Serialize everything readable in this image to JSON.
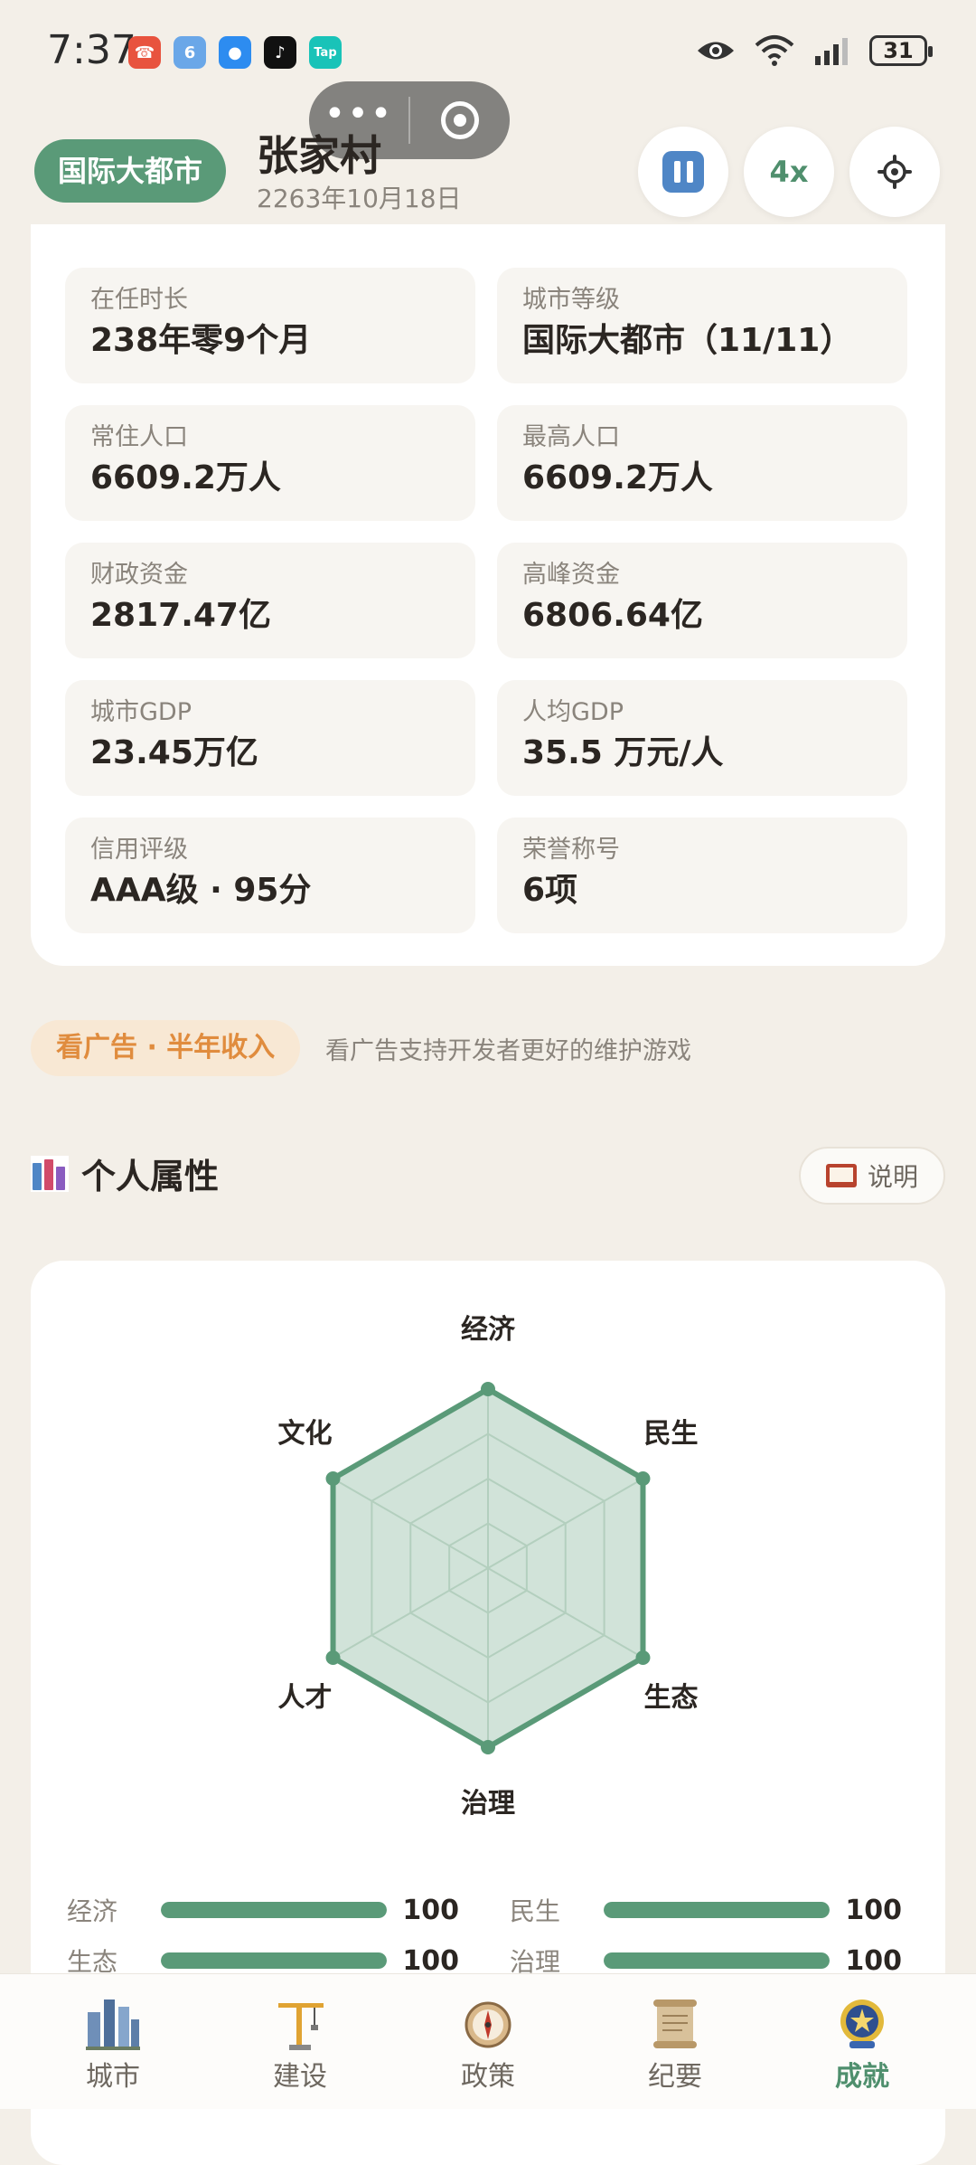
{
  "status_bar": {
    "time": "7:37",
    "battery": "31",
    "apps": [
      {
        "name": "phone-app-icon",
        "glyph": "☎",
        "color": "#e8533e"
      },
      {
        "name": "six-app-icon",
        "glyph": "6",
        "color": "#6aa7e8"
      },
      {
        "name": "chat-app-icon",
        "glyph": "●",
        "color": "#2d8cf0"
      },
      {
        "name": "tiktok-app-icon",
        "glyph": "♪",
        "color": "#111111"
      },
      {
        "name": "taptap-app-icon",
        "glyph": "Tap",
        "color": "#19c3b8"
      }
    ]
  },
  "header": {
    "level_pill": "国际大都市",
    "city_name": "张家村",
    "date": "2263年10月18日",
    "speed_label": "4x"
  },
  "stats": [
    {
      "label": "在任时长",
      "value": "238年零9个月"
    },
    {
      "label": "城市等级",
      "value": "国际大都市（11/11）"
    },
    {
      "label": "常住人口",
      "value": "6609.2万人"
    },
    {
      "label": "最高人口",
      "value": "6609.2万人"
    },
    {
      "label": "财政资金",
      "value": "2817.47亿"
    },
    {
      "label": "高峰资金",
      "value": "6806.64亿"
    },
    {
      "label": "城市GDP",
      "value": "23.45万亿"
    },
    {
      "label": "人均GDP",
      "value": "35.5 万元/人"
    },
    {
      "label": "信用评级",
      "value": "AAA级 · 95分"
    },
    {
      "label": "荣誉称号",
      "value": "6项"
    }
  ],
  "ad": {
    "button_label": "看广告 · 半年收入",
    "description": "看广告支持开发者更好的维护游戏"
  },
  "attributes_section": {
    "title": "个人属性",
    "explain_label": "说明"
  },
  "chart_data": {
    "type": "radar",
    "axes": [
      "经济",
      "民生",
      "生态",
      "治理",
      "人才",
      "文化"
    ],
    "values": [
      100,
      100,
      100,
      100,
      100,
      100
    ],
    "max": 100,
    "rings": 4,
    "color": "#5a9a78"
  },
  "attribute_bars": [
    {
      "label": "经济",
      "value": 100
    },
    {
      "label": "民生",
      "value": 100
    },
    {
      "label": "生态",
      "value": 100
    },
    {
      "label": "治理",
      "value": 100
    }
  ],
  "tabs": [
    {
      "label": "城市",
      "icon": "city-icon",
      "active": false
    },
    {
      "label": "建设",
      "icon": "crane-icon",
      "active": false
    },
    {
      "label": "政策",
      "icon": "compass-icon",
      "active": false
    },
    {
      "label": "纪要",
      "icon": "scroll-icon",
      "active": false
    },
    {
      "label": "成就",
      "icon": "badge-icon",
      "active": true
    }
  ]
}
